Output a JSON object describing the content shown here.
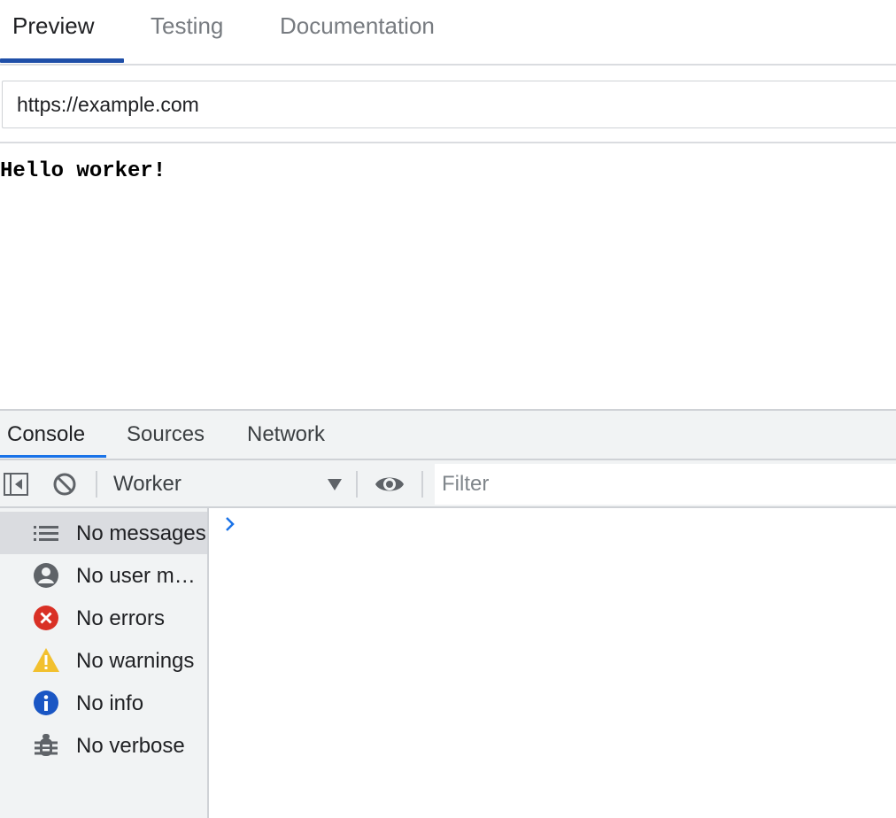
{
  "top_tabs": [
    {
      "label": "Preview",
      "active": true
    },
    {
      "label": "Testing",
      "active": false
    },
    {
      "label": "Documentation",
      "active": false
    }
  ],
  "url_bar": {
    "value": "https://example.com"
  },
  "preview": {
    "text": "Hello worker!"
  },
  "devtools": {
    "tabs": [
      {
        "label": "Console",
        "active": true
      },
      {
        "label": "Sources",
        "active": false
      },
      {
        "label": "Network",
        "active": false
      }
    ],
    "toolbar": {
      "context": "Worker",
      "filter_placeholder": "Filter",
      "icons": [
        "sidebar-toggle-icon",
        "clear-console-icon",
        "chevron-down-icon",
        "eye-icon"
      ]
    },
    "sidebar": {
      "items": [
        {
          "label": "No messages",
          "icon": "list-icon",
          "selected": true
        },
        {
          "label": "No user messages",
          "icon": "user-icon",
          "selected": false
        },
        {
          "label": "No errors",
          "icon": "error-icon",
          "selected": false
        },
        {
          "label": "No warnings",
          "icon": "warning-icon",
          "selected": false
        },
        {
          "label": "No info",
          "icon": "info-icon",
          "selected": false
        },
        {
          "label": "No verbose",
          "icon": "bug-icon",
          "selected": false
        }
      ]
    }
  },
  "colors": {
    "active_tab_underline": "#1f4fa8",
    "devtools_tab_underline": "#1a73e8",
    "error": "#d93025",
    "warning": "#f2c02e",
    "info": "#1a56c4",
    "prompt": "#1a73e8"
  }
}
